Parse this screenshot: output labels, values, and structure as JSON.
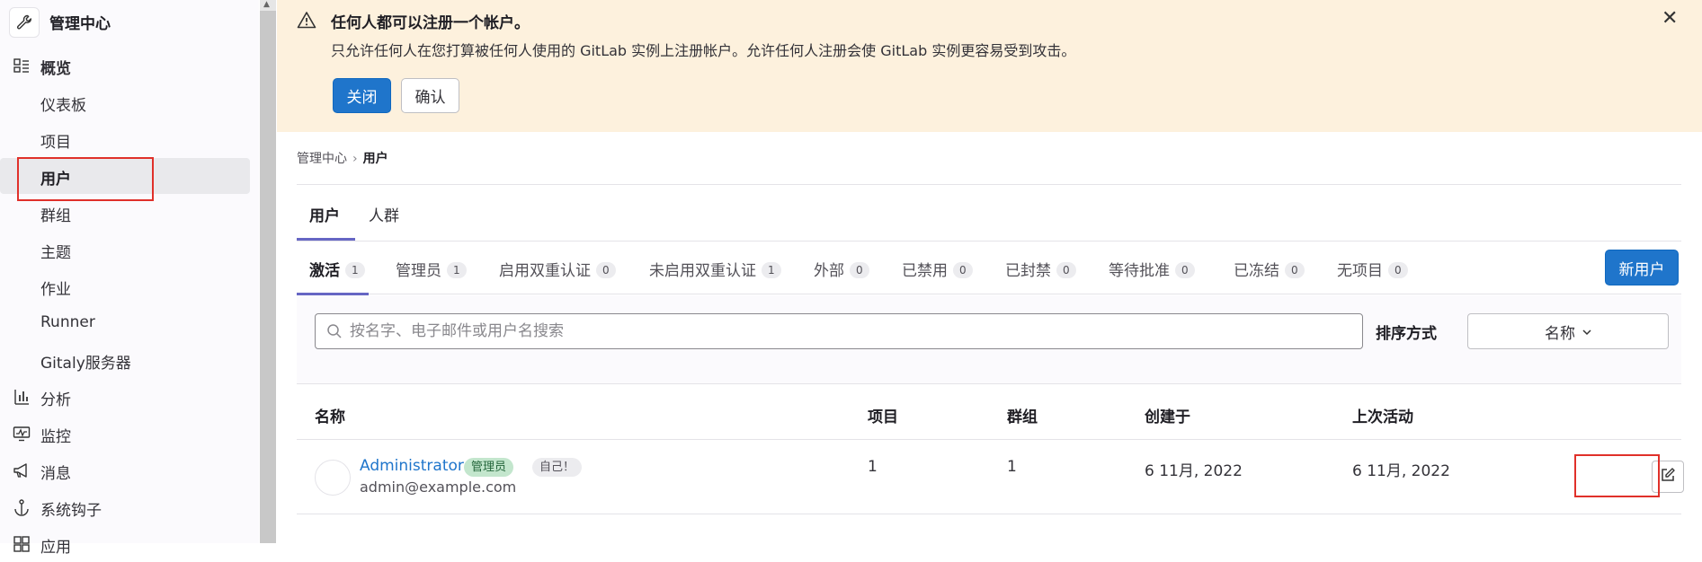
{
  "sidebar": {
    "title": "管理中心",
    "items": [
      {
        "label": "概览",
        "icon": "overview-icon"
      },
      {
        "label": "仪表板"
      },
      {
        "label": "项目"
      },
      {
        "label": "用户"
      },
      {
        "label": "群组"
      },
      {
        "label": "主题"
      },
      {
        "label": "作业"
      },
      {
        "label": "Runner"
      },
      {
        "label": "Gitaly服务器"
      },
      {
        "label": "分析",
        "icon": "analytics-icon"
      },
      {
        "label": "监控",
        "icon": "monitor-icon"
      },
      {
        "label": "消息",
        "icon": "messages-icon"
      },
      {
        "label": "系统钩子",
        "icon": "hook-icon"
      },
      {
        "label": "应用",
        "icon": "apps-icon"
      }
    ],
    "active": "用户"
  },
  "banner": {
    "title": "任何人都可以注册一个帐户。",
    "text": "只允许任何人在您打算被任何人使用的 GitLab 实例上注册帐户。允许任何人注册会使 GitLab 实例更容易受到攻击。",
    "close_label": "关闭",
    "confirm_label": "确认"
  },
  "breadcrumb": {
    "root": "管理中心",
    "current": "用户"
  },
  "top_tabs": [
    {
      "label": "用户"
    },
    {
      "label": "人群"
    }
  ],
  "filter_tabs": [
    {
      "label": "激活",
      "count": "1"
    },
    {
      "label": "管理员",
      "count": "1"
    },
    {
      "label": "启用双重认证",
      "count": "0"
    },
    {
      "label": "未启用双重认证",
      "count": "1"
    },
    {
      "label": "外部",
      "count": "0"
    },
    {
      "label": "已禁用",
      "count": "0"
    },
    {
      "label": "已封禁",
      "count": "0"
    },
    {
      "label": "等待批准",
      "count": "0"
    },
    {
      "label": "已冻结",
      "count": "0"
    },
    {
      "label": "无项目",
      "count": "0"
    }
  ],
  "new_user_label": "新用户",
  "search": {
    "placeholder": "按名字、电子邮件或用户名搜索"
  },
  "sort": {
    "label": "排序方式",
    "value": "名称"
  },
  "table": {
    "headers": {
      "name": "名称",
      "projects": "项目",
      "groups": "群组",
      "created": "创建于",
      "last_activity": "上次活动"
    },
    "rows": [
      {
        "name": "Administrator",
        "badge_admin": "管理员",
        "badge_self": "自己！",
        "email": "admin@example.com",
        "projects": "1",
        "groups": "1",
        "created": "6 11月, 2022",
        "last_activity": "6 11月, 2022"
      }
    ]
  },
  "colors": {
    "primary": "#1f75cb",
    "banner_bg": "#fdf1dd",
    "annotation_red": "#e0302a",
    "tab_underline": "#6666c4"
  }
}
